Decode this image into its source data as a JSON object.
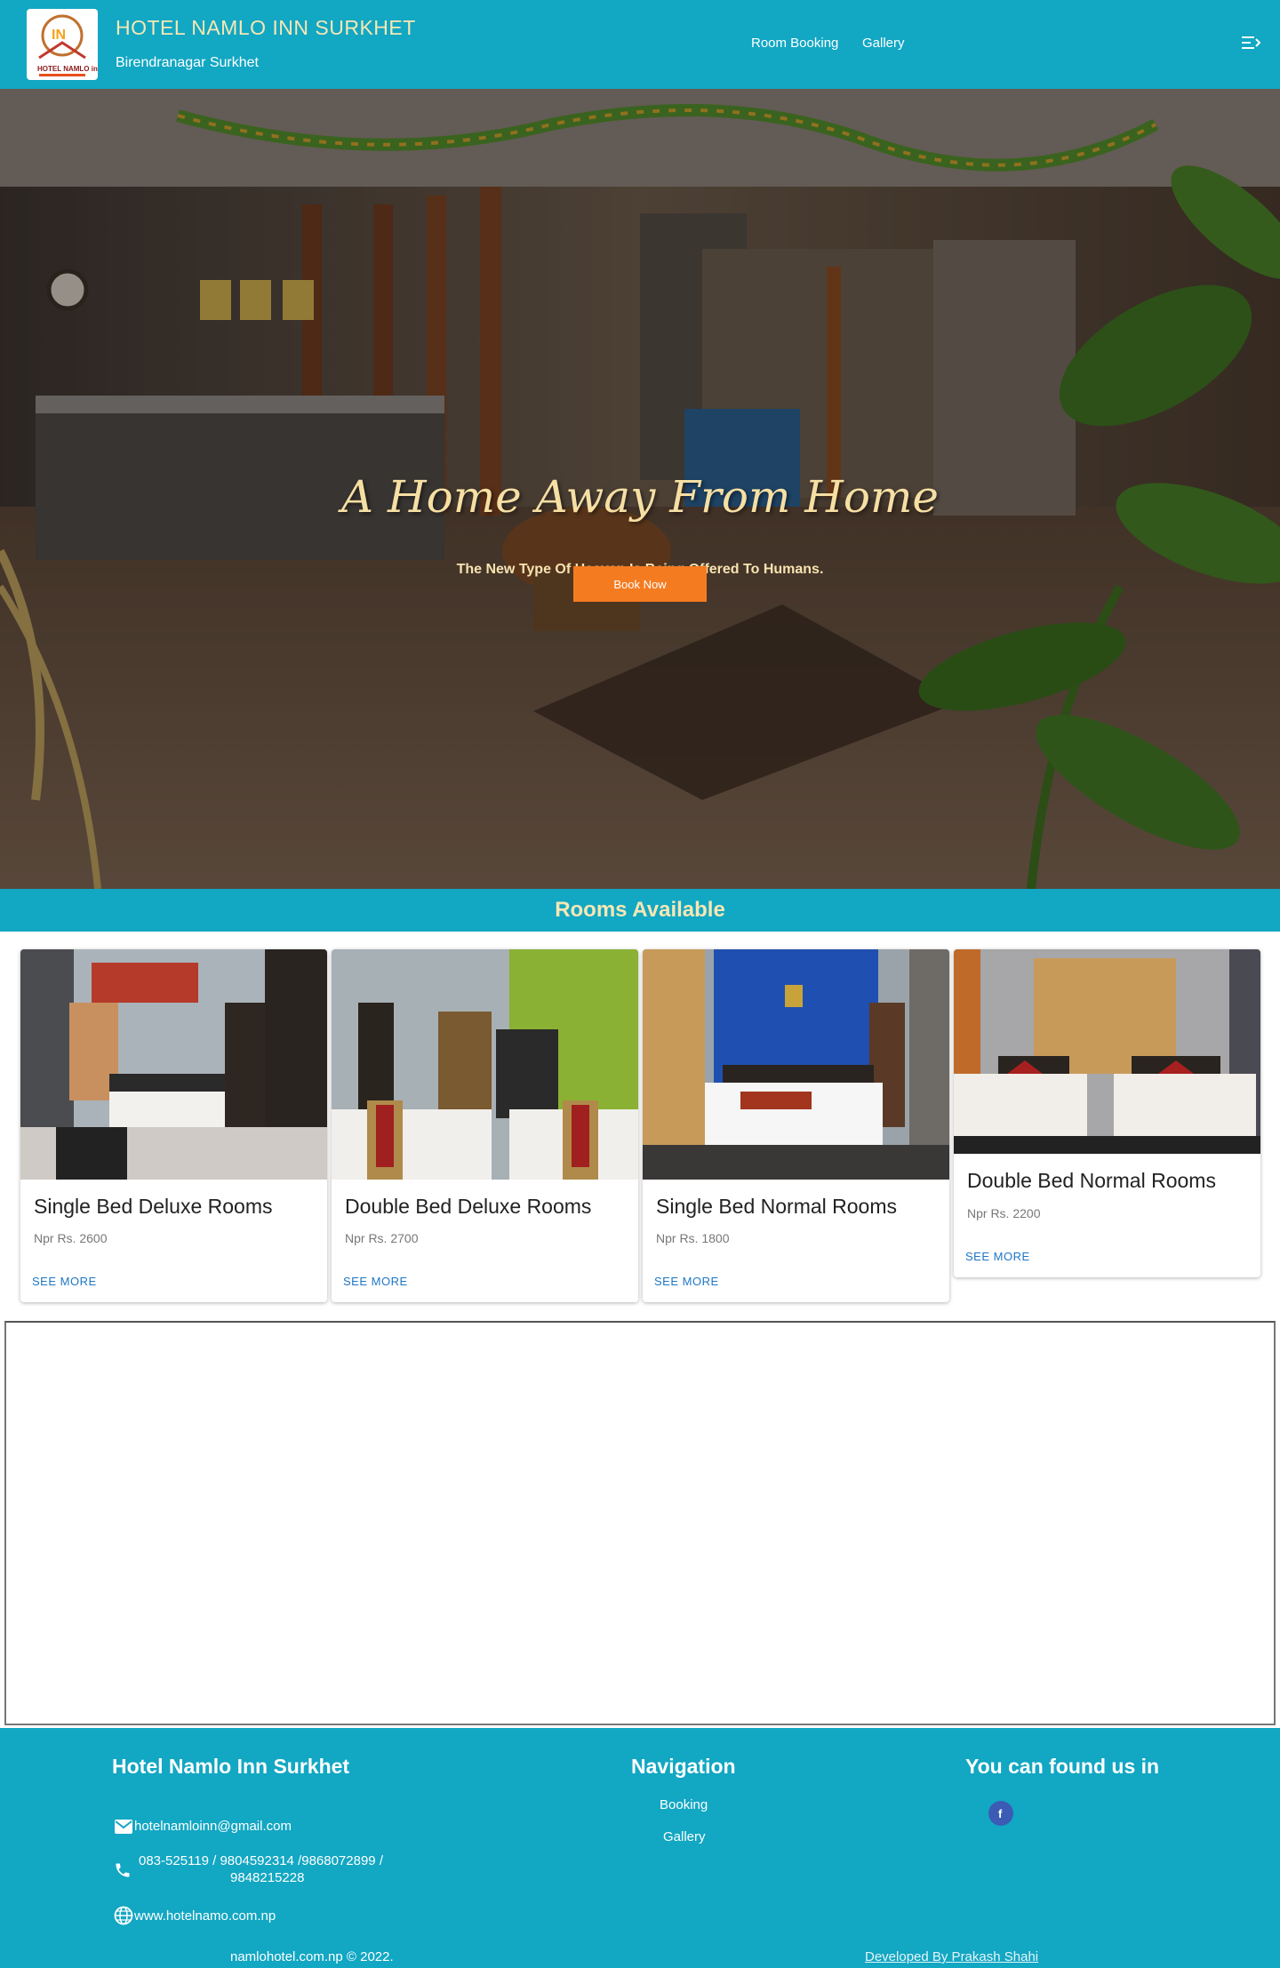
{
  "header": {
    "title": "HOTEL NAMLO INN SURKHET",
    "subtitle": "Birendranagar Surkhet",
    "logo_text": "HOTEL NAMLO inn",
    "nav": [
      "Room Booking",
      "Gallery"
    ],
    "menu_icon": "menu-icon"
  },
  "hero": {
    "title": "A Home Away From Home",
    "subtitle": "The New Type Of Heaven Is Being Offered To Humans.",
    "button": "Book Now"
  },
  "rooms": {
    "heading": "Rooms Available",
    "items": [
      {
        "name": "Single Bed Deluxe Rooms",
        "price": "Npr Rs. 2600",
        "link": "SEE MORE"
      },
      {
        "name": "Double Bed Deluxe Rooms",
        "price": "Npr Rs. 2700",
        "link": "SEE MORE"
      },
      {
        "name": "Single Bed Normal Rooms",
        "price": "Npr Rs. 1800",
        "link": "SEE MORE"
      },
      {
        "name": "Double Bed Normal Rooms",
        "price": "Npr Rs. 2200",
        "link": "SEE MORE"
      }
    ]
  },
  "footer": {
    "brand": "Hotel Namlo Inn Surkhet",
    "email": "hotelnamloinn@gmail.com",
    "phone_line1": "083-525119 / 9804592314 /9868072899 /",
    "phone_line2": "9848215228",
    "website": "www.hotelnamo.com.np",
    "nav_heading": "Navigation",
    "nav_links": [
      "Booking",
      "Gallery"
    ],
    "social_heading": "You can found us in",
    "social_icon": "facebook-icon",
    "copyright": "namlohotel.com.np © 2022.",
    "developer": "Developed By Prakash Shahi"
  },
  "colors": {
    "primary": "#12a7c3",
    "accent": "#f47b20",
    "title_cream": "#f7e7b4",
    "link_blue": "#1e77c4"
  }
}
